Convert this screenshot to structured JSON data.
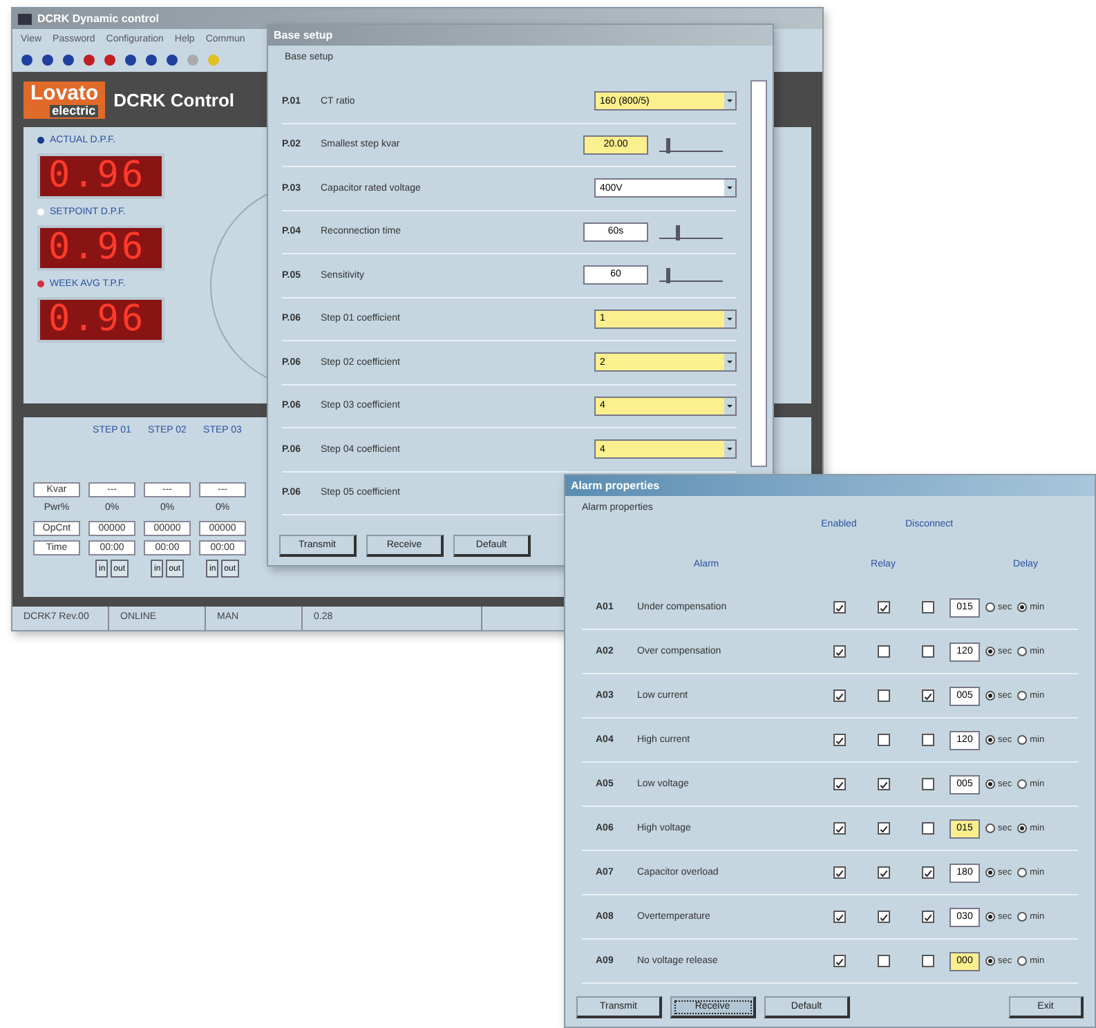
{
  "main_window": {
    "title": "DCRK Dynamic control",
    "menu": [
      "View",
      "Password",
      "Configuration",
      "Help",
      "Commun"
    ],
    "logo": {
      "brand": "Lovato",
      "sub": "electric"
    },
    "header_title": "DCRK Control",
    "readings": [
      {
        "label": "ACTUAL D.P.F.",
        "value": "0.96",
        "color": "#1a3a8a"
      },
      {
        "label": "SETPOINT D.P.F.",
        "value": "0.96",
        "color": "#ffffff"
      },
      {
        "label": "WEEK AVG T.P.F.",
        "value": "0.96",
        "color": "#d03040"
      }
    ],
    "steps": {
      "row_labels": [
        "Kvar",
        "Pwr%",
        "OpCnt",
        "Time"
      ],
      "columns": [
        {
          "name": "STEP 01",
          "kvar": "---",
          "pwr": "0%",
          "op_cnt": "00000",
          "time": "00:00",
          "buttons": [
            "in",
            "out"
          ]
        },
        {
          "name": "STEP 02",
          "kvar": "---",
          "pwr": "0%",
          "op_cnt": "00000",
          "time": "00:00",
          "buttons": [
            "in",
            "out"
          ]
        },
        {
          "name": "STEP 03",
          "kvar": "---",
          "pwr": "0%",
          "op_cnt": "00000",
          "time": "00:00",
          "buttons": [
            "in",
            "out"
          ]
        }
      ]
    },
    "status_bar": [
      "DCRK7 Rev.00",
      "ONLINE",
      "MAN",
      "0.28"
    ]
  },
  "base_setup": {
    "title": "Base setup",
    "group": "Base setup",
    "rows": [
      {
        "code": "P.01",
        "label": "CT ratio",
        "kind": "select",
        "value": "160   (800/5)",
        "highlighted": true
      },
      {
        "code": "P.02",
        "label": "Smallest step kvar",
        "kind": "slider",
        "value": "20.00",
        "highlighted": true,
        "level": 0.1
      },
      {
        "code": "P.03",
        "label": "Capacitor rated voltage",
        "kind": "select",
        "value": "400V",
        "highlighted": false
      },
      {
        "code": "P.04",
        "label": "Reconnection time",
        "kind": "slider",
        "value": "60s",
        "highlighted": false,
        "level": 0.25
      },
      {
        "code": "P.05",
        "label": "Sensitivity",
        "kind": "slider",
        "value": "60",
        "highlighted": false,
        "level": 0.1
      },
      {
        "code": "P.06",
        "label": "Step 01 coefficient",
        "kind": "select",
        "value": "1",
        "highlighted": true
      },
      {
        "code": "P.06",
        "label": "Step 02 coefficient",
        "kind": "select",
        "value": "2",
        "highlighted": true
      },
      {
        "code": "P.06",
        "label": "Step 03 coefficient",
        "kind": "select",
        "value": "4",
        "highlighted": true
      },
      {
        "code": "P.06",
        "label": "Step 04 coefficient",
        "kind": "select",
        "value": "4",
        "highlighted": true
      },
      {
        "code": "P.06",
        "label": "Step 05 coefficient",
        "kind": "none"
      }
    ],
    "buttons": [
      "Transmit",
      "Receive",
      "Default"
    ]
  },
  "alarm_properties": {
    "title": "Alarm properties",
    "group": "Alarm properties",
    "headers": {
      "alarm": "Alarm",
      "enabled": "Enabled",
      "relay": "Relay",
      "disconnect": "Disconnect",
      "delay": "Delay"
    },
    "rows": [
      {
        "code": "A01",
        "name": "Under compensation",
        "enabled": true,
        "relay": true,
        "disconnect": false,
        "delay": "015",
        "highlighted": false,
        "units": [
          {
            "label": "sec",
            "selected": false
          },
          {
            "label": "min",
            "selected": true
          }
        ]
      },
      {
        "code": "A02",
        "name": "Over compensation",
        "enabled": true,
        "relay": false,
        "disconnect": false,
        "delay": "120",
        "highlighted": false,
        "units": [
          {
            "label": "sec",
            "selected": true
          },
          {
            "label": "min",
            "selected": false
          }
        ]
      },
      {
        "code": "A03",
        "name": "Low current",
        "enabled": true,
        "relay": false,
        "disconnect": true,
        "delay": "005",
        "highlighted": false,
        "units": [
          {
            "label": "sec",
            "selected": true
          },
          {
            "label": "min",
            "selected": false
          }
        ]
      },
      {
        "code": "A04",
        "name": "High current",
        "enabled": true,
        "relay": false,
        "disconnect": false,
        "delay": "120",
        "highlighted": false,
        "units": [
          {
            "label": "sec",
            "selected": true
          },
          {
            "label": "min",
            "selected": false
          }
        ]
      },
      {
        "code": "A05",
        "name": "Low voltage",
        "enabled": true,
        "relay": true,
        "disconnect": false,
        "delay": "005",
        "highlighted": false,
        "units": [
          {
            "label": "sec",
            "selected": true
          },
          {
            "label": "min",
            "selected": false
          }
        ]
      },
      {
        "code": "A06",
        "name": "High voltage",
        "enabled": true,
        "relay": true,
        "disconnect": false,
        "delay": "015",
        "highlighted": true,
        "units": [
          {
            "label": "sec",
            "selected": false
          },
          {
            "label": "min",
            "selected": true
          }
        ]
      },
      {
        "code": "A07",
        "name": "Capacitor overload",
        "enabled": true,
        "relay": true,
        "disconnect": true,
        "delay": "180",
        "highlighted": false,
        "units": [
          {
            "label": "sec",
            "selected": true
          },
          {
            "label": "min",
            "selected": false
          }
        ]
      },
      {
        "code": "A08",
        "name": "Overtemperature",
        "enabled": true,
        "relay": true,
        "disconnect": true,
        "delay": "030",
        "highlighted": false,
        "units": [
          {
            "label": "sec",
            "selected": true
          },
          {
            "label": "min",
            "selected": false
          }
        ]
      },
      {
        "code": "A09",
        "name": "No voltage release",
        "enabled": true,
        "relay": false,
        "disconnect": false,
        "delay": "000",
        "highlighted": true,
        "units": [
          {
            "label": "sec",
            "selected": true
          },
          {
            "label": "min",
            "selected": false
          }
        ]
      }
    ],
    "buttons": [
      {
        "label": "Transmit",
        "selected": false
      },
      {
        "label": "Receive",
        "selected": true
      },
      {
        "label": "Default",
        "selected": false
      }
    ],
    "exit_button": "Exit"
  }
}
